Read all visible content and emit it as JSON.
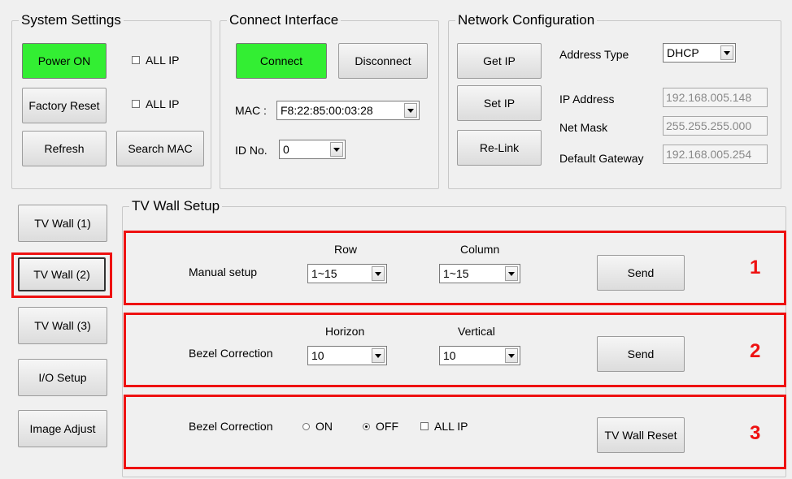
{
  "system_settings": {
    "title": "System Settings",
    "power_on": "Power ON",
    "power_all_ip": "ALL IP",
    "factory_reset": "Factory Reset",
    "factory_all_ip": "ALL IP",
    "refresh": "Refresh",
    "search_mac": "Search MAC"
  },
  "connect_interface": {
    "title": "Connect Interface",
    "connect": "Connect",
    "disconnect": "Disconnect",
    "mac_label": "MAC :",
    "mac_value": "F8:22:85:00:03:28",
    "id_label": "ID No.",
    "id_value": "0"
  },
  "network": {
    "title": "Network Configuration",
    "get_ip": "Get IP",
    "set_ip": "Set IP",
    "relink": "Re-Link",
    "address_type_label": "Address Type",
    "address_type_value": "DHCP",
    "ip_label": "IP Address",
    "ip_value": "192.168.005.148",
    "mask_label": "Net Mask",
    "mask_value": "255.255.255.000",
    "gateway_label": "Default Gateway",
    "gateway_value": "192.168.005.254"
  },
  "left_nav": {
    "tv_wall_1": "TV Wall (1)",
    "tv_wall_2": "TV Wall (2)",
    "tv_wall_3": "TV Wall (3)",
    "io_setup": "I/O Setup",
    "image_adjust": "Image Adjust"
  },
  "tv_wall_setup": {
    "title": "TV Wall Setup",
    "manual": {
      "label": "Manual setup",
      "row_header": "Row",
      "row_value": "1~15",
      "column_header": "Column",
      "column_value": "1~15",
      "send": "Send",
      "number": "1"
    },
    "bezel": {
      "label": "Bezel Correction",
      "horizon_header": "Horizon",
      "horizon_value": "10",
      "vertical_header": "Vertical",
      "vertical_value": "10",
      "send": "Send",
      "number": "2"
    },
    "bezel_toggle": {
      "label": "Bezel Correction",
      "on": "ON",
      "off": "OFF",
      "all_ip": "ALL IP",
      "reset": "TV Wall Reset",
      "number": "3",
      "selected": "OFF"
    }
  },
  "colors": {
    "active_green": "#33ee33",
    "highlight_red": "#ee1111"
  }
}
